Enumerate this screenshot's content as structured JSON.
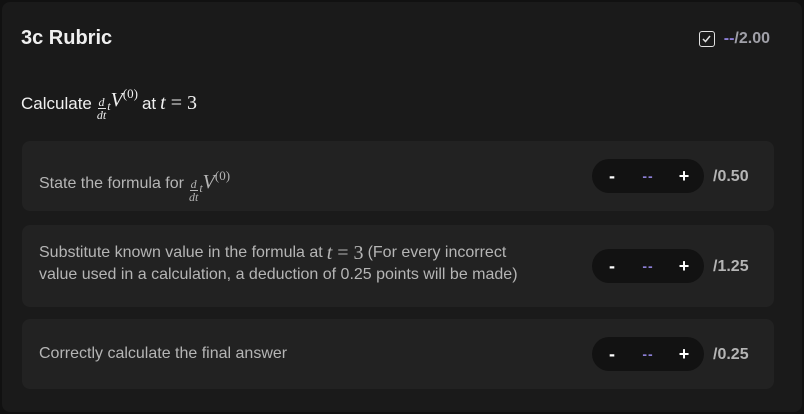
{
  "header": {
    "title": "3c Rubric",
    "total_value": "--",
    "total_max": "/2.00"
  },
  "prompt": {
    "prefix": "Calculate",
    "at_word": "at"
  },
  "items": [
    {
      "text": "State the formula for",
      "value": "--",
      "max": "/0.50"
    },
    {
      "text_line1": "Substitute known value in the formula at",
      "text_line1_tail": "(For every incorrect",
      "text_line2": "value used in a calculation, a deduction of 0.25 points will be made)",
      "value": "--",
      "max": "/1.25"
    },
    {
      "text": "Correctly calculate the final answer",
      "value": "--",
      "max": "/0.25"
    }
  ],
  "stepper": {
    "minus": "-",
    "plus": "+"
  },
  "math": {
    "d": "d",
    "dt": "dt",
    "t": "t",
    "V": "V",
    "sup": "(0)",
    "eq": "= 3"
  },
  "colors": {
    "accent": "#8c7fd6",
    "panel": "#1a1a1a",
    "item": "#222222"
  }
}
